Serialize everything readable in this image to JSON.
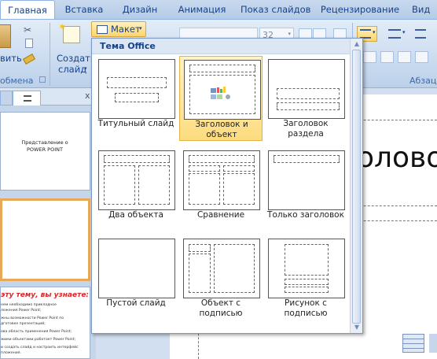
{
  "tabs": [
    "Главная",
    "Вставка",
    "Дизайн",
    "Анимация",
    "Показ слайдов",
    "Рецензирование",
    "Вид"
  ],
  "ribbon": {
    "paste_label_partial": "вить",
    "clipboard_group_partial": "обмена",
    "create_slide": "Создать",
    "create_slide_line2": "слайд",
    "layout_button": "Макет",
    "font_size": "32",
    "paragraph_group": "Абзац"
  },
  "left_pane": {
    "close_partial": "x",
    "slide1_line1": "Представление о",
    "slide1_line2": "POWER POINT",
    "slide3_heading": "эту тему, вы узнаете:",
    "slide3_lines": [
      "нем необходимо прикладное",
      "ложения Power Point;",
      "жны возможности Power Point по",
      "дготовке презентаций;",
      "ова область применения Power Point;",
      "жими объектами работает Power Point;",
      "и создать слайд и настроить интерфейс",
      "пложения."
    ]
  },
  "slide_text_partial": "олово",
  "gallery": {
    "title": "Тема Office",
    "items": [
      {
        "label": "Титульный слайд"
      },
      {
        "label": "Заголовок и объект"
      },
      {
        "label": "Заголовок раздела"
      },
      {
        "label": "Два объекта"
      },
      {
        "label": "Сравнение"
      },
      {
        "label": "Только заголовок"
      },
      {
        "label": "Пустой слайд"
      },
      {
        "label": "Объект с подписью"
      },
      {
        "label": "Рисунок с подписью"
      }
    ],
    "selected_index": 1
  }
}
